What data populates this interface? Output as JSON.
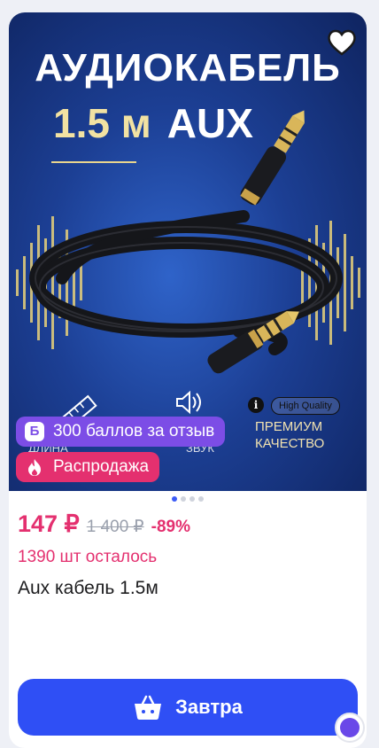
{
  "product_image": {
    "headline": "АУДИОКАБЕЛЬ",
    "length": "1.5 м",
    "type": "AUX",
    "quality_badge": "High Quality",
    "premium_line1": "ПРЕМИУМ",
    "premium_line2": "КАЧЕСТВО",
    "info_glyph": "i",
    "caption_left": "ДЛИНА",
    "caption_mid": "ЗВУК"
  },
  "badges": {
    "points_icon": "Б",
    "points": "300 баллов за отзыв",
    "sale": "Распродажа"
  },
  "pricing": {
    "price": "147 ₽",
    "old_price": "1 400 ₽",
    "discount": "-89%"
  },
  "stock": "1390 шт осталось",
  "product_title": "Aux кабель 1.5м",
  "cta": {
    "label": "Завтра"
  },
  "carousel": {
    "count": 4,
    "active": 0
  },
  "colors": {
    "accent": "#2f4ff5",
    "price": "#e4306f",
    "points_badge": "#7c4de6",
    "sale_badge": "#e4306f"
  },
  "icons": [
    "heart-icon",
    "flame-icon",
    "basket-icon",
    "ruler-icon",
    "speaker-icon",
    "info-icon"
  ]
}
